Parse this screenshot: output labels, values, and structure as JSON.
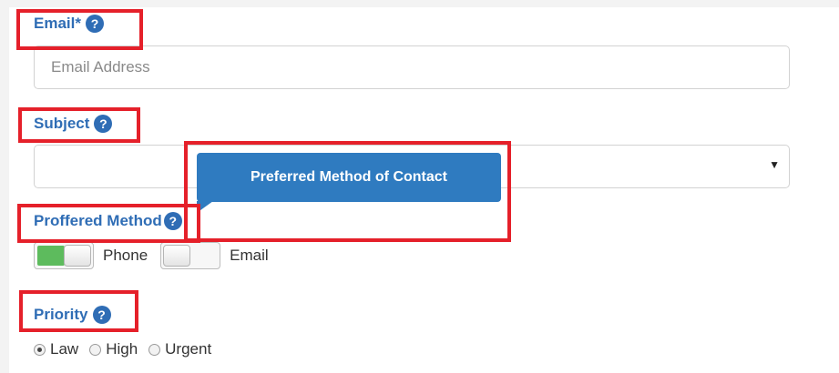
{
  "form": {
    "email_label": "Email*",
    "email_placeholder": "Email Address",
    "email_value": "",
    "subject_label": "Subject",
    "subject_selected": "",
    "contact_label": "Proffered Method",
    "contact_tooltip": "Preferred Method of Contact",
    "contact_options": [
      {
        "label": "Phone",
        "on": true
      },
      {
        "label": "Email",
        "on": false
      }
    ],
    "priority_label": "Priority",
    "priority_options": [
      {
        "label": "Law",
        "checked": true
      },
      {
        "label": "High",
        "checked": false
      },
      {
        "label": "Urgent",
        "checked": false
      }
    ]
  },
  "icons": {
    "help": "question-circle-icon",
    "help_glyph": "?",
    "dropdown_glyph": "▼"
  },
  "colors": {
    "label": "#2f6db5",
    "tooltip": "#2f7bc0",
    "toggle_on": "#5dbb5d",
    "highlight": "#e5202a"
  }
}
